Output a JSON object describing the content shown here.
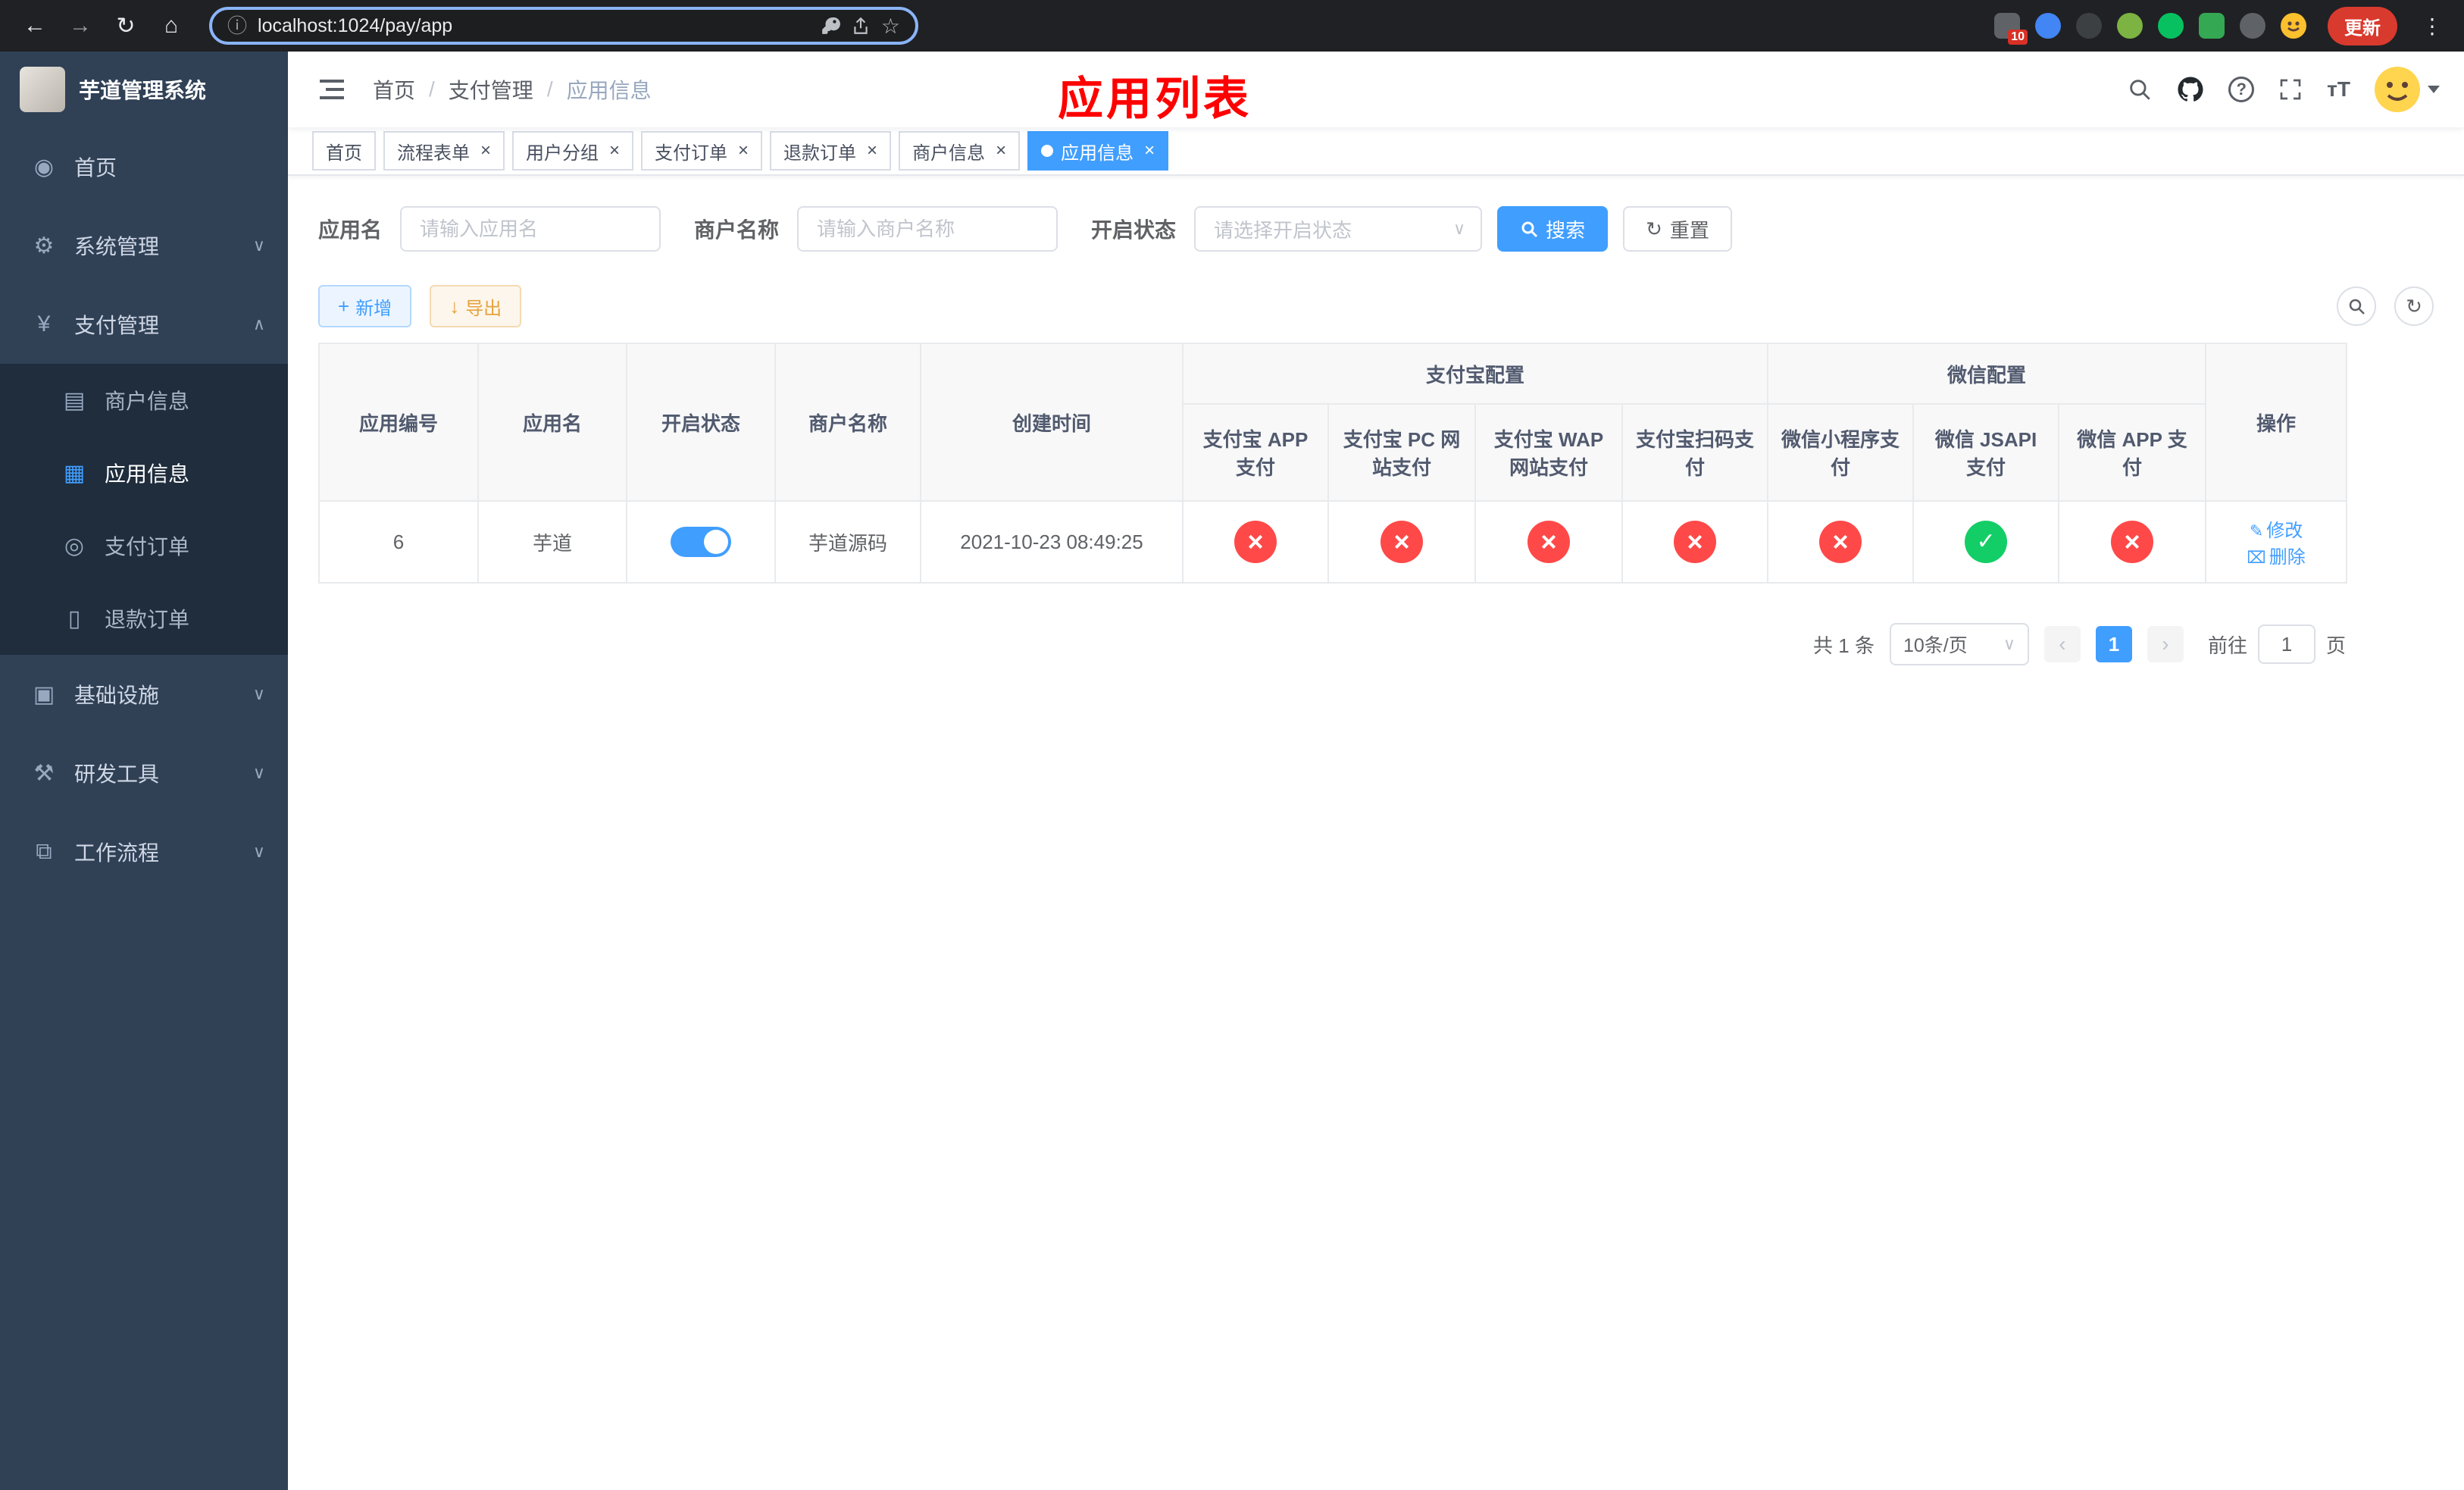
{
  "browser": {
    "url": "localhost:1024/pay/app",
    "update_label": "更新",
    "extensions_badge": "10"
  },
  "sidebar": {
    "title": "芋道管理系统",
    "items": [
      {
        "label": "首页",
        "icon": "◉"
      },
      {
        "label": "系统管理",
        "icon": "⚙"
      },
      {
        "label": "支付管理",
        "icon": "¥"
      },
      {
        "label": "商户信息",
        "icon": "▤"
      },
      {
        "label": "应用信息",
        "icon": "▦"
      },
      {
        "label": "支付订单",
        "icon": "◎"
      },
      {
        "label": "退款订单",
        "icon": "▯"
      },
      {
        "label": "基础设施",
        "icon": "▣"
      },
      {
        "label": "研发工具",
        "icon": "⚒"
      },
      {
        "label": "工作流程",
        "icon": "⧉"
      }
    ]
  },
  "header": {
    "breadcrumb": [
      "首页",
      "支付管理",
      "应用信息"
    ],
    "page_title": "应用列表"
  },
  "tabs": [
    {
      "label": "首页"
    },
    {
      "label": "流程表单"
    },
    {
      "label": "用户分组"
    },
    {
      "label": "支付订单"
    },
    {
      "label": "退款订单"
    },
    {
      "label": "商户信息"
    },
    {
      "label": "应用信息"
    }
  ],
  "filters": {
    "app_name_label": "应用名",
    "app_name_placeholder": "请输入应用名",
    "merchant_label": "商户名称",
    "merchant_placeholder": "请输入商户名称",
    "status_label": "开启状态",
    "status_placeholder": "请选择开启状态",
    "search_label": "搜索",
    "reset_label": "重置"
  },
  "toolbar": {
    "add_label": "新增",
    "export_label": "导出"
  },
  "table": {
    "groups": {
      "alipay": "支付宝配置",
      "wechat": "微信配置"
    },
    "columns": [
      "应用编号",
      "应用名",
      "开启状态",
      "商户名称",
      "创建时间",
      "支付宝 APP 支付",
      "支付宝 PC 网站支付",
      "支付宝 WAP 网站支付",
      "支付宝扫码支付",
      "微信小程序支付",
      "微信 JSAPI 支付",
      "微信 APP 支付",
      "操作"
    ],
    "rows": [
      {
        "id": "6",
        "name": "芋道",
        "enabled": true,
        "merchant": "芋道源码",
        "created": "2021-10-23 08:49:25",
        "statuses": {
          "alipay_app": false,
          "alipay_pc": false,
          "alipay_wap": false,
          "alipay_qr": false,
          "wechat_lite": false,
          "wechat_jsapi": true,
          "wechat_app": false
        },
        "actions": {
          "edit": "修改",
          "delete": "删除"
        }
      }
    ]
  },
  "pagination": {
    "total": "共 1 条",
    "page_size": "10条/页",
    "page": "1",
    "goto_label": "前往",
    "goto_value": "1",
    "goto_unit": "页"
  }
}
